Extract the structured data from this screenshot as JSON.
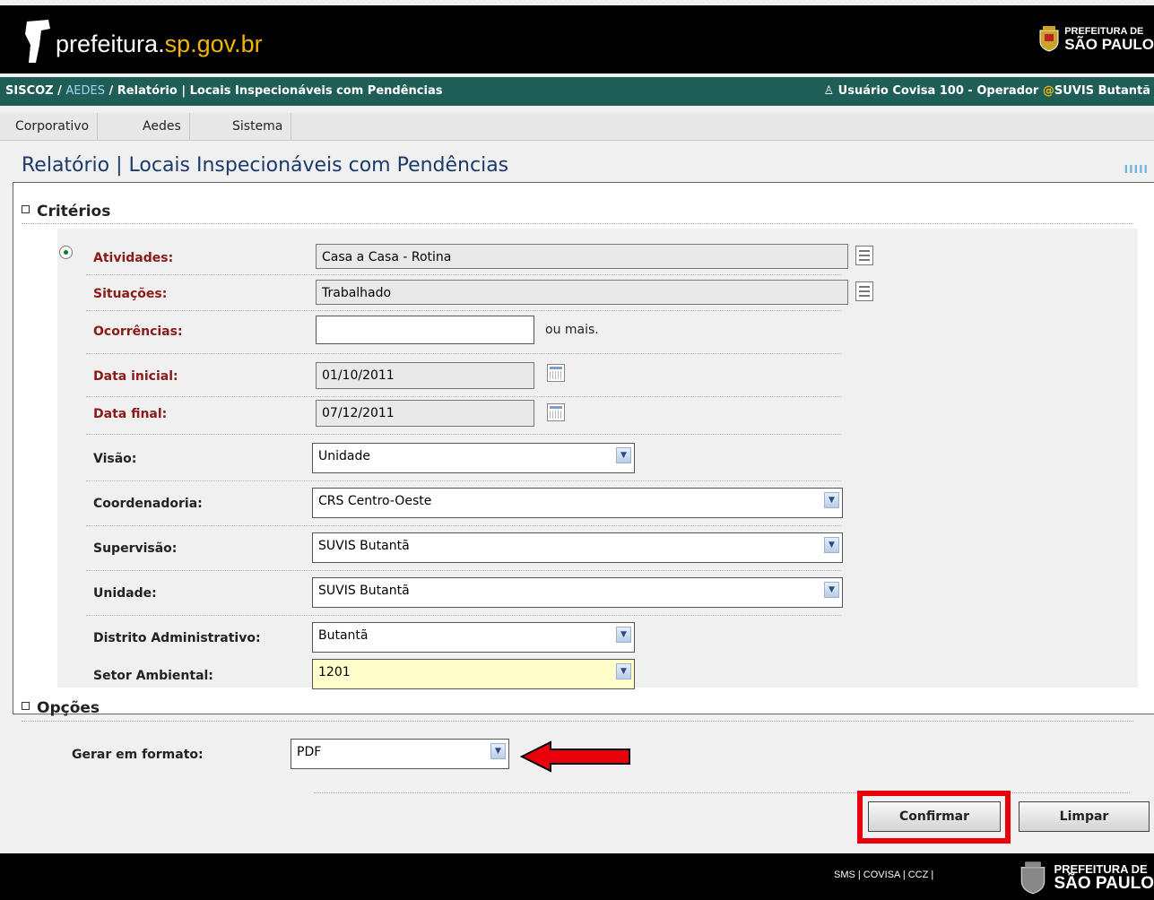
{
  "header": {
    "site_name_main": "prefeitura.",
    "site_name_accent": "sp.gov.br",
    "logo_line1": "PREFEITURA DE",
    "logo_line2": "SÃO PAULO"
  },
  "breadcrumb": {
    "root": "SISCOZ",
    "sep1": " / ",
    "module": "AEDES",
    "rest": " / Relatório | Locais Inspecionáveis com Pendências",
    "user": "Usuário Covisa 100 - Operador",
    "at": "@",
    "unit": "SUVIS Butantã"
  },
  "menu": [
    "Corporativo",
    "Aedes",
    "Sistema"
  ],
  "page_title": "Relatório | Locais Inspecionáveis com Pendências",
  "title_marks": "IIIII",
  "sections": {
    "criterios": "Critérios",
    "opcoes": "Opções"
  },
  "fields": {
    "atividades": {
      "label": "Atividades:",
      "value": "Casa a Casa - Rotina"
    },
    "situacoes": {
      "label": "Situações:",
      "value": "Trabalhado"
    },
    "ocorrencias": {
      "label": "Ocorrências:",
      "value": "",
      "suffix": "ou mais."
    },
    "data_inicial": {
      "label": "Data inicial:",
      "value": "01/10/2011"
    },
    "data_final": {
      "label": "Data final:",
      "value": "07/12/2011"
    },
    "visao": {
      "label": "Visão:",
      "value": "Unidade"
    },
    "coordenadoria": {
      "label": "Coordenadoria:",
      "value": "CRS Centro-Oeste"
    },
    "supervisao": {
      "label": "Supervisão:",
      "value": "SUVIS Butantã"
    },
    "unidade": {
      "label": "Unidade:",
      "value": "SUVIS Butantã"
    },
    "distrito": {
      "label": "Distrito Administrativo:",
      "value": "Butantã"
    },
    "setor": {
      "label": "Setor Ambiental:",
      "value": "1201"
    },
    "formato": {
      "label": "Gerar em formato:",
      "value": "PDF"
    }
  },
  "buttons": {
    "confirmar": "Confirmar",
    "limpar": "Limpar"
  },
  "footer": {
    "links": "SMS | COVISA | CCZ |",
    "logo_line1": "PREFEITURA DE",
    "logo_line2": "SÃO PAULO"
  },
  "colors": {
    "accent_yellow": "#f2b705",
    "breadcrumb_bg": "#1f5d57",
    "required_label": "#8b1a1a",
    "highlight_red": "#e8000b"
  }
}
